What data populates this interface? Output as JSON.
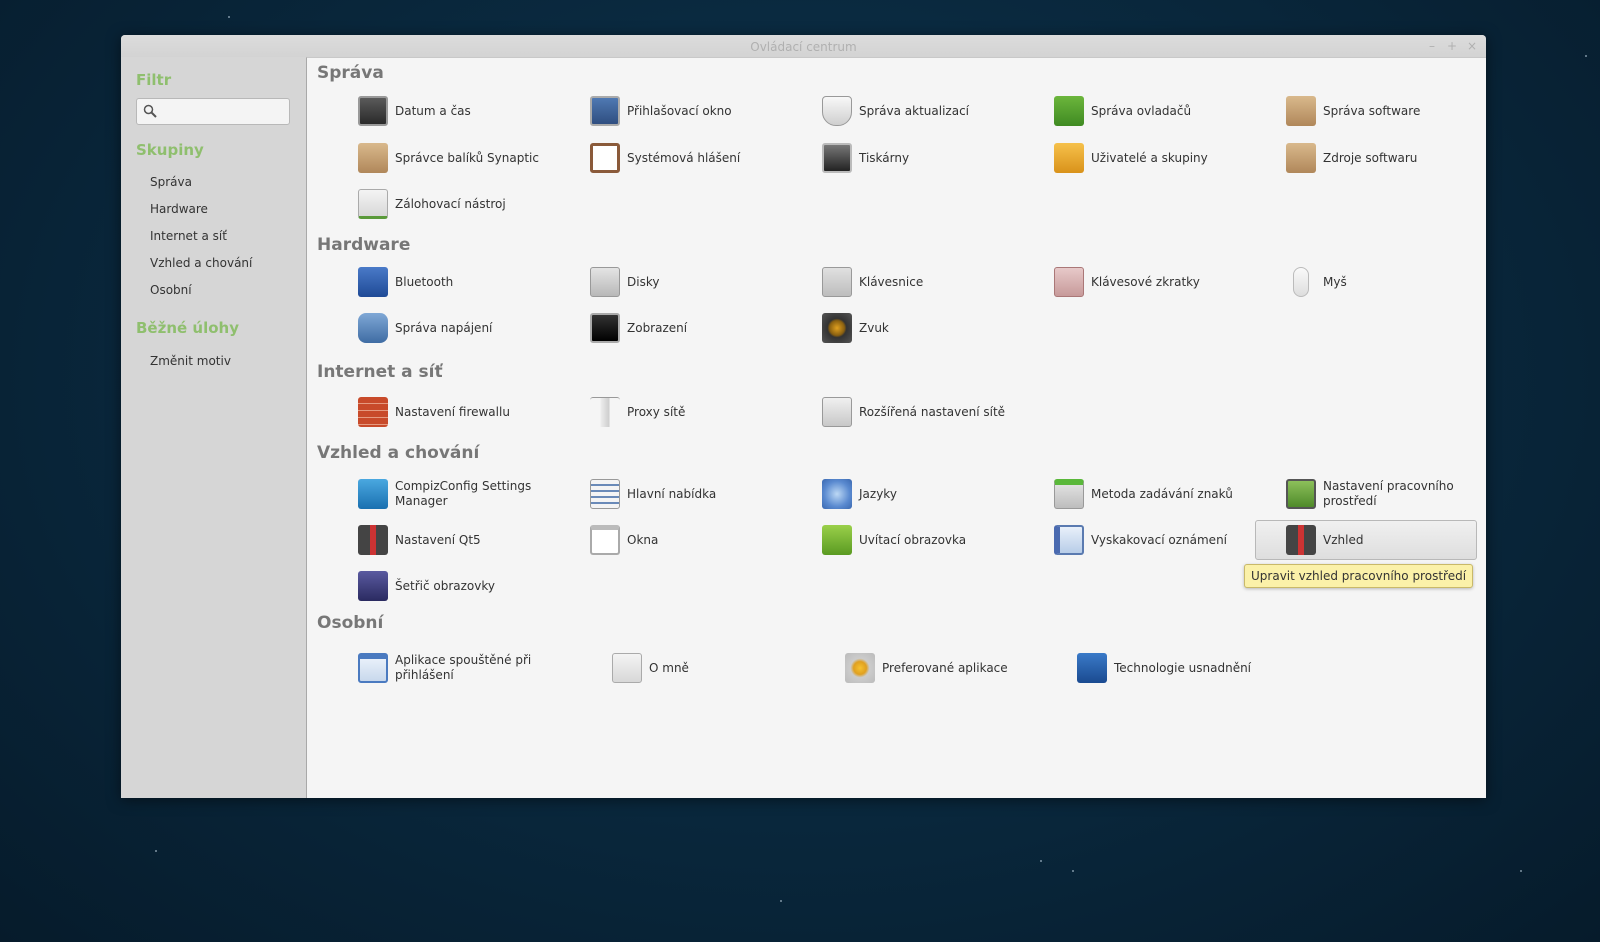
{
  "window": {
    "title": "Ovládací centrum",
    "controls": {
      "minimize": "–",
      "maximize": "+",
      "close": "×"
    }
  },
  "sidebar": {
    "filter_heading": "Filtr",
    "search": {
      "value": "",
      "placeholder": "",
      "icon": "search-icon"
    },
    "groups_heading": "Skupiny",
    "groups": [
      {
        "label": "Správa"
      },
      {
        "label": "Hardware"
      },
      {
        "label": "Internet a síť"
      },
      {
        "label": "Vzhled a chování"
      },
      {
        "label": "Osobní"
      }
    ],
    "tasks_heading": "Běžné úlohy",
    "tasks": [
      {
        "label": "Změnit motiv"
      }
    ]
  },
  "sections": [
    {
      "title": "Správa",
      "items": [
        {
          "label": "Datum a čas",
          "icon": "clock-icon"
        },
        {
          "label": "Přihlašovací okno",
          "icon": "login-window-icon"
        },
        {
          "label": "Správa aktualizací",
          "icon": "shield-icon"
        },
        {
          "label": "Správa ovladačů",
          "icon": "circuit-board-icon"
        },
        {
          "label": "Správa software",
          "icon": "package-icon"
        },
        {
          "label": "Správce balíků Synaptic",
          "icon": "package-download-icon"
        },
        {
          "label": "Systémová hlášení",
          "icon": "clipboard-alert-icon"
        },
        {
          "label": "Tiskárny",
          "icon": "printer-icon"
        },
        {
          "label": "Uživatelé a skupiny",
          "icon": "users-icon"
        },
        {
          "label": "Zdroje softwaru",
          "icon": "package-source-icon"
        },
        {
          "label": "Zálohovací nástroj",
          "icon": "backup-icon"
        }
      ]
    },
    {
      "title": "Hardware",
      "items": [
        {
          "label": "Bluetooth",
          "icon": "bluetooth-icon"
        },
        {
          "label": "Disky",
          "icon": "disk-icon"
        },
        {
          "label": "Klávesnice",
          "icon": "keyboard-icon"
        },
        {
          "label": "Klávesové zkratky",
          "icon": "keyboard-shortcuts-icon"
        },
        {
          "label": "Myš",
          "icon": "mouse-icon"
        },
        {
          "label": "Správa napájení",
          "icon": "power-icon"
        },
        {
          "label": "Zobrazení",
          "icon": "display-icon"
        },
        {
          "label": "Zvuk",
          "icon": "speaker-icon"
        }
      ]
    },
    {
      "title": "Internet a síť",
      "items": [
        {
          "label": "Nastavení firewallu",
          "icon": "firewall-icon"
        },
        {
          "label": "Proxy sítě",
          "icon": "proxy-icon"
        },
        {
          "label": "Rozšířená nastavení sítě",
          "icon": "network-port-icon"
        }
      ]
    },
    {
      "title": "Vzhled a chování",
      "items": [
        {
          "label": "CompizConfig Settings Manager",
          "icon": "pointer-icon"
        },
        {
          "label": "Hlavní nabídka",
          "icon": "menu-editor-icon"
        },
        {
          "label": "Jazyky",
          "icon": "globe-icon"
        },
        {
          "label": "Metoda zadávání znaků",
          "icon": "input-method-icon"
        },
        {
          "label": "Nastavení pracovního prostředí",
          "icon": "desktop-settings-icon"
        },
        {
          "label": "Nastavení Qt5",
          "icon": "suit-icon"
        },
        {
          "label": "Okna",
          "icon": "window-icon"
        },
        {
          "label": "Uvítací obrazovka",
          "icon": "mint-logo-icon"
        },
        {
          "label": "Vyskakovací oznámení",
          "icon": "notification-icon"
        },
        {
          "label": "Vzhled",
          "icon": "suit-icon",
          "active": true
        },
        {
          "label": "Šetřič obrazovky",
          "icon": "screensaver-icon"
        }
      ]
    },
    {
      "title": "Osobní",
      "items": [
        {
          "label": "Aplikace spouštěné při přihlášení",
          "icon": "startup-apps-icon"
        },
        {
          "label": "O mně",
          "icon": "about-me-icon"
        },
        {
          "label": "Preferované aplikace",
          "icon": "preferred-apps-icon"
        },
        {
          "label": "Technologie usnadnění",
          "icon": "accessibility-icon"
        }
      ]
    }
  ],
  "tooltip": {
    "text": "Upravit vzhled pracovního prostředí"
  }
}
